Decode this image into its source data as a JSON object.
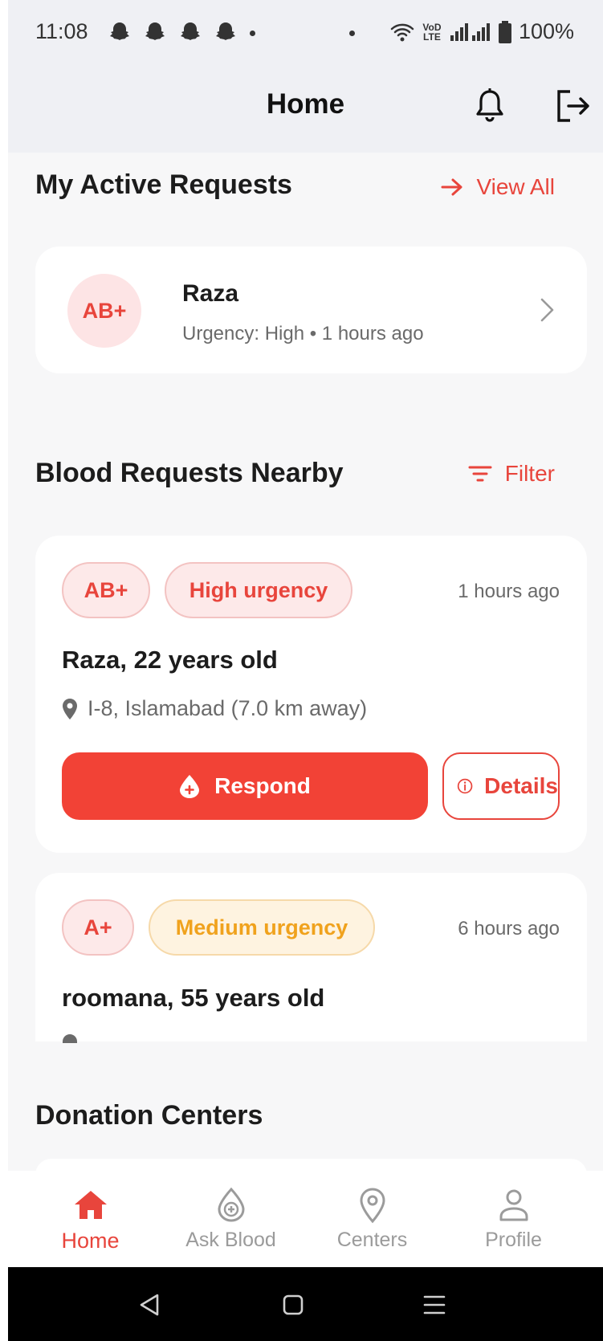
{
  "status_bar": {
    "time": "11:08",
    "battery": "100%",
    "network_label": "VoD LTE"
  },
  "app_bar": {
    "title": "Home"
  },
  "active_requests": {
    "title": "My Active Requests",
    "view_all": "View All",
    "items": [
      {
        "blood_type": "AB+",
        "name": "Raza",
        "subtitle": "Urgency: High • 1 hours ago"
      }
    ]
  },
  "nearby": {
    "title": "Blood Requests Nearby",
    "filter": "Filter",
    "requests": [
      {
        "blood_type": "AB+",
        "urgency": "High urgency",
        "time_ago": "1 hours ago",
        "name": "Raza, 22 years old",
        "location": "I-8, Islamabad (7.0 km away)",
        "respond_label": "Respond",
        "details_label": "Details"
      },
      {
        "blood_type": "A+",
        "urgency": "Medium urgency",
        "time_ago": "6 hours ago",
        "name": "roomana, 55 years old"
      }
    ]
  },
  "donation_centers": {
    "title": "Donation Centers"
  },
  "bottom_nav": [
    {
      "label": "Home",
      "icon": "home-icon",
      "active": true
    },
    {
      "label": "Ask Blood",
      "icon": "blood-drop-plus-icon",
      "active": false
    },
    {
      "label": "Centers",
      "icon": "location-pin-icon",
      "active": false
    },
    {
      "label": "Profile",
      "icon": "person-icon",
      "active": false
    }
  ],
  "colors": {
    "accent": "#e8453c",
    "button": "#f24236",
    "medium": "#f0a21d",
    "background": "#f7f7f8"
  }
}
